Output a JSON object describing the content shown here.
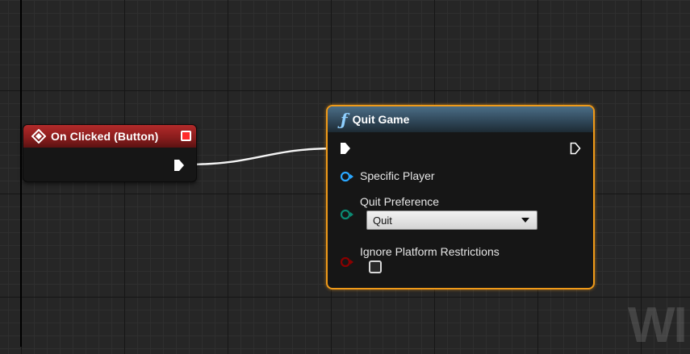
{
  "event_node": {
    "title": "On Clicked (Button)",
    "header_color": "#8a1d1d",
    "icon": "event-diamond-icon"
  },
  "function_node": {
    "title": "Quit Game",
    "header_color": "#2e4556",
    "selected_outline_color": "#f09a19",
    "icon": "function-f-icon",
    "pins": {
      "specific_player": {
        "label": "Specific Player",
        "color": "#2aa7ff"
      },
      "quit_preference": {
        "label": "Quit Preference",
        "value": "Quit",
        "color": "#0b8a73"
      },
      "ignore_platform_restrictions": {
        "label": "Ignore Platform Restrictions",
        "checked": false,
        "color": "#8b0000"
      }
    }
  },
  "watermark_text": "WI"
}
